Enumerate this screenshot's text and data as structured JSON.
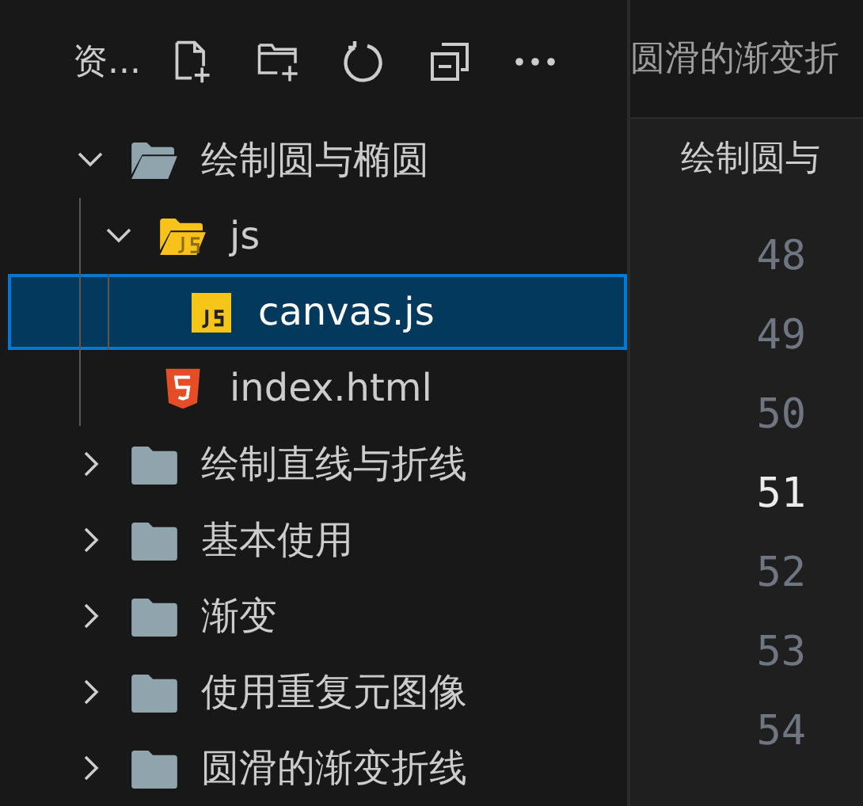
{
  "sidebar": {
    "title": "资...",
    "tree": [
      {
        "name": "绘制圆与椭圆",
        "kind": "folder",
        "expanded": true,
        "selected": false,
        "children": [
          {
            "name": "js",
            "kind": "js-folder",
            "expanded": true,
            "selected": false,
            "children": [
              {
                "name": "canvas.js",
                "kind": "js",
                "selected": true
              }
            ]
          },
          {
            "name": "index.html",
            "kind": "html",
            "selected": false
          }
        ]
      },
      {
        "name": "绘制直线与折线",
        "kind": "folder",
        "expanded": false,
        "selected": false
      },
      {
        "name": "基本使用",
        "kind": "folder",
        "expanded": false,
        "selected": false
      },
      {
        "name": "渐变",
        "kind": "folder",
        "expanded": false,
        "selected": false
      },
      {
        "name": "使用重复元图像",
        "kind": "folder",
        "expanded": false,
        "selected": false
      },
      {
        "name": "圆滑的渐变折线",
        "kind": "folder",
        "expanded": false,
        "selected": false
      }
    ]
  },
  "editor": {
    "tab_title": "圆滑的渐变折",
    "breadcrumb": "绘制圆与",
    "line_numbers": [
      {
        "text": "48",
        "current": false
      },
      {
        "text": "49",
        "current": false
      },
      {
        "text": "50",
        "current": false
      },
      {
        "text": "51",
        "current": true
      },
      {
        "text": "52",
        "current": false
      },
      {
        "text": "53",
        "current": false
      },
      {
        "text": "54",
        "current": false
      }
    ]
  }
}
